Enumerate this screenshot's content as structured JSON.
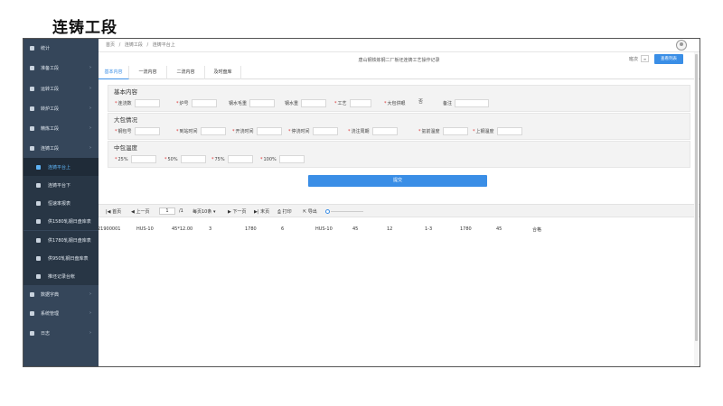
{
  "page_title": "连铸工段",
  "sidebar": {
    "items": [
      {
        "label": "统计",
        "level": 0,
        "chevron": false
      },
      {
        "label": "准备工段",
        "level": 0,
        "chevron": true
      },
      {
        "label": "运转工段",
        "level": 0,
        "chevron": true
      },
      {
        "label": "转炉工段",
        "level": 0,
        "chevron": true
      },
      {
        "label": "精炼工段",
        "level": 0,
        "chevron": true
      },
      {
        "label": "连铸工段",
        "level": 0,
        "chevron": true
      },
      {
        "label": "连铸平台上",
        "level": 1,
        "active": true
      },
      {
        "label": "连铸平台下",
        "level": 1
      },
      {
        "label": "恒速率报表",
        "level": 1
      },
      {
        "label": "供1580轧钢日盘库表",
        "level": 1
      },
      {
        "label": "供1780轧钢日盘库表",
        "level": 1
      },
      {
        "label": "供950轧钢日盘库表",
        "level": 1
      },
      {
        "label": "推坯记录台帐",
        "level": 1
      },
      {
        "label": "数据字典",
        "level": 0,
        "chevron": true
      },
      {
        "label": "系统管理",
        "level": 0,
        "chevron": true
      },
      {
        "label": "日志",
        "level": 0,
        "chevron": true
      }
    ]
  },
  "breadcrumb": [
    "首页",
    "/",
    "连铸工段",
    "/",
    "连铸平台上"
  ],
  "record_title": "唐山钢铁炼钢二厂板坯连铸工艺操作记录",
  "header": {
    "shift_label": "班次",
    "msg_label": "≡",
    "query_button": "查看列表"
  },
  "tabs": [
    "基本内容",
    "一流内容",
    "二流内容",
    "及时盘库"
  ],
  "sections": {
    "basic": {
      "title": "基本内容",
      "fields": [
        {
          "label": "连浇数",
          "required": true
        },
        {
          "label": "炉号",
          "required": true
        },
        {
          "label": "钢水毛重",
          "required": false
        },
        {
          "label": "钢水重",
          "required": false
        },
        {
          "label": "工艺",
          "required": true
        },
        {
          "label": "大包供眼",
          "required": true,
          "value": "否"
        },
        {
          "label": "备注",
          "required": false
        }
      ]
    },
    "ladle": {
      "title": "大包情况",
      "fields": [
        {
          "label": "钢包号",
          "required": true
        },
        {
          "label": "到站时间",
          "required": true
        },
        {
          "label": "开浇时间",
          "required": true
        },
        {
          "label": "停浇时间",
          "required": true
        },
        {
          "label": "浇注周期",
          "required": true
        },
        {
          "label": "氩前温度",
          "required": true
        },
        {
          "label": "上钢温度",
          "required": true
        }
      ]
    },
    "tundish": {
      "title": "中包温度",
      "fields": [
        {
          "label": "25%",
          "required": true
        },
        {
          "label": "50%",
          "required": true
        },
        {
          "label": "75%",
          "required": true
        },
        {
          "label": "100%",
          "required": true
        }
      ]
    }
  },
  "submit_label": "提交",
  "pager": {
    "first": "首页",
    "prev": "上一页",
    "page_value": "1",
    "page_total": "/1",
    "per_page": "每页10条 ▾",
    "next": "下一页",
    "last": "末页",
    "print": "打印",
    "export": "导出"
  },
  "table_row": [
    "21900001",
    "HUS-10",
    "45*12.00",
    "3",
    "1780",
    "6",
    "HUS-10",
    "45",
    "12",
    "1-3",
    "1780",
    "45",
    "合格"
  ],
  "colors": {
    "sidebar": "#35465a",
    "accent": "#3a8ee6",
    "active_text": "#5eb3f5"
  }
}
